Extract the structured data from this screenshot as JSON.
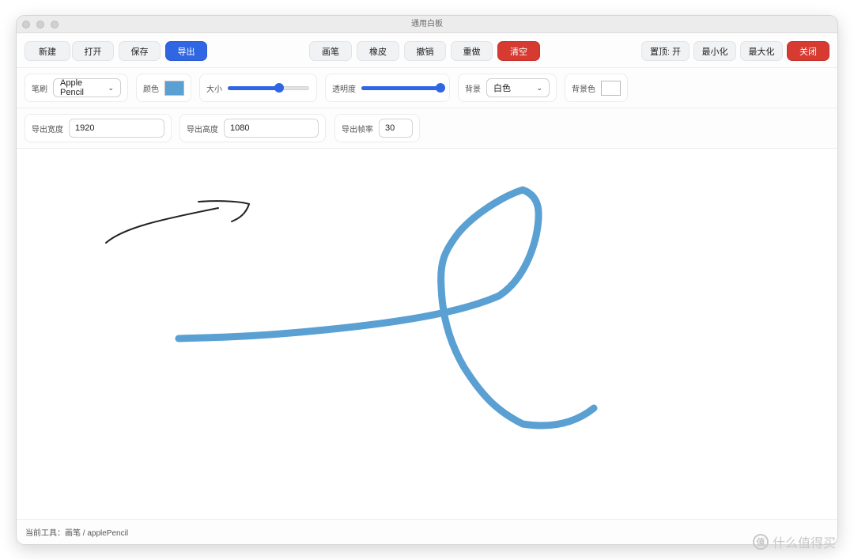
{
  "window": {
    "title": "通用白板"
  },
  "toolbar": {
    "new_label": "新建",
    "open_label": "打开",
    "save_label": "保存",
    "export_label": "导出",
    "pen_label": "画笔",
    "eraser_label": "橡皮",
    "undo_label": "撤销",
    "redo_label": "重做",
    "clear_label": "清空",
    "pin_label": "置顶: 开",
    "minimize_label": "最小化",
    "maximize_label": "最大化",
    "close_label": "关闭"
  },
  "brush": {
    "label": "笔刷",
    "value": "Apple Pencil",
    "color_label": "颜色",
    "color": "#5aa0d2",
    "size_label": "大小",
    "size_level": 0.63,
    "opacity_label": "透明度",
    "opacity_level": 0.97,
    "background_label": "背景",
    "background_value": "白色",
    "bgcolor_label": "背景色",
    "bgcolor": "#ffffff"
  },
  "export": {
    "width_label": "导出宽度",
    "width_value": "1920",
    "height_label": "导出高度",
    "height_value": "1080",
    "fps_label": "导出帧率",
    "fps_value": "30"
  },
  "status": {
    "text": "当前工具：画笔 / applePencil"
  },
  "colors": {
    "accent": "#3166e3",
    "danger": "#d63a31",
    "stroke_blue": "#5aa0d2",
    "stroke_black": "#222222"
  },
  "watermark": {
    "icon": "值",
    "text": "什么值得买"
  }
}
